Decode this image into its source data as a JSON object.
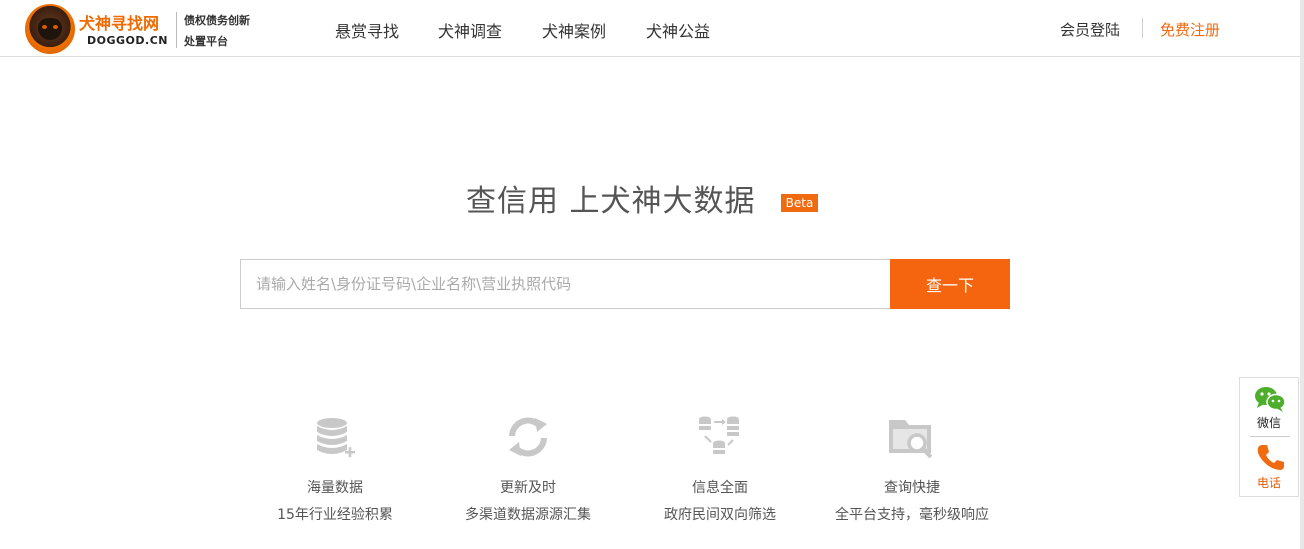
{
  "brand": {
    "name": "犬神寻找网",
    "domain": "DOGGOD.CN",
    "slogan_line1": "债权债务创新",
    "slogan_line2": "处置平台"
  },
  "nav": {
    "items": [
      {
        "label": "悬赏寻找"
      },
      {
        "label": "犬神调查"
      },
      {
        "label": "犬神案例"
      },
      {
        "label": "犬神公益"
      }
    ]
  },
  "auth": {
    "login_label": "会员登陆",
    "register_label": "免费注册"
  },
  "hero": {
    "headline": "查信用  上犬神大数据",
    "badge": "Beta"
  },
  "search": {
    "placeholder": "请输入姓名\\身份证号码\\企业名称\\营业执照代码",
    "value": "",
    "button_label": "查一下"
  },
  "features": [
    {
      "icon": "database-add-icon",
      "title": "海量数据",
      "desc": "15年行业经验积累"
    },
    {
      "icon": "refresh-icon",
      "title": "更新及时",
      "desc": "多渠道数据源源汇集"
    },
    {
      "icon": "data-exchange-icon",
      "title": "信息全面",
      "desc": "政府民间双向筛选"
    },
    {
      "icon": "folder-search-icon",
      "title": "查询快捷",
      "desc": "全平台支持，毫秒级响应"
    }
  ],
  "side_widget": {
    "wechat_label": "微信",
    "phone_label": "电话"
  },
  "colors": {
    "accent": "#f5650f",
    "icon_gray": "#c8c8c8",
    "wechat_green": "#4cae2b"
  }
}
